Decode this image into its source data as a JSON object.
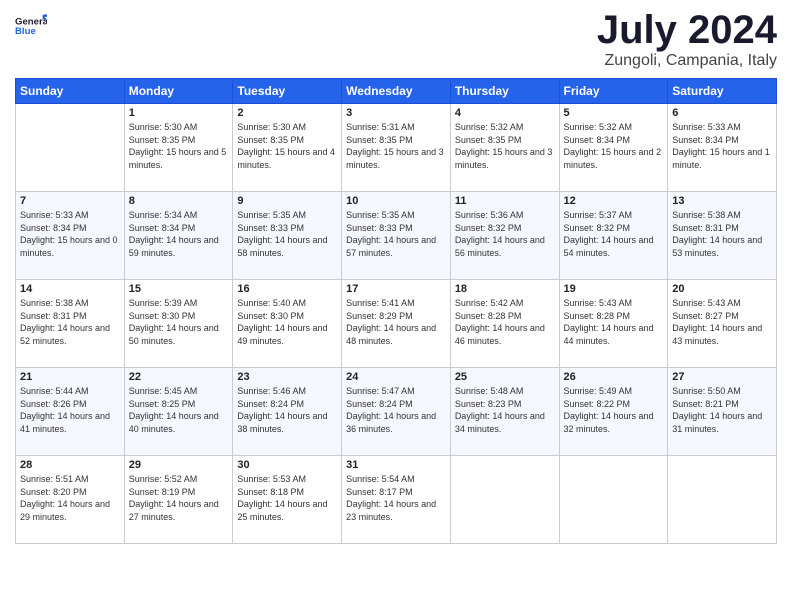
{
  "header": {
    "logo_general": "General",
    "logo_blue": "Blue",
    "month_title": "July 2024",
    "location": "Zungoli, Campania, Italy"
  },
  "days_of_week": [
    "Sunday",
    "Monday",
    "Tuesday",
    "Wednesday",
    "Thursday",
    "Friday",
    "Saturday"
  ],
  "weeks": [
    [
      {
        "day": "",
        "sunrise": "",
        "sunset": "",
        "daylight": ""
      },
      {
        "day": "1",
        "sunrise": "Sunrise: 5:30 AM",
        "sunset": "Sunset: 8:35 PM",
        "daylight": "Daylight: 15 hours and 5 minutes."
      },
      {
        "day": "2",
        "sunrise": "Sunrise: 5:30 AM",
        "sunset": "Sunset: 8:35 PM",
        "daylight": "Daylight: 15 hours and 4 minutes."
      },
      {
        "day": "3",
        "sunrise": "Sunrise: 5:31 AM",
        "sunset": "Sunset: 8:35 PM",
        "daylight": "Daylight: 15 hours and 3 minutes."
      },
      {
        "day": "4",
        "sunrise": "Sunrise: 5:32 AM",
        "sunset": "Sunset: 8:35 PM",
        "daylight": "Daylight: 15 hours and 3 minutes."
      },
      {
        "day": "5",
        "sunrise": "Sunrise: 5:32 AM",
        "sunset": "Sunset: 8:34 PM",
        "daylight": "Daylight: 15 hours and 2 minutes."
      },
      {
        "day": "6",
        "sunrise": "Sunrise: 5:33 AM",
        "sunset": "Sunset: 8:34 PM",
        "daylight": "Daylight: 15 hours and 1 minute."
      }
    ],
    [
      {
        "day": "7",
        "sunrise": "Sunrise: 5:33 AM",
        "sunset": "Sunset: 8:34 PM",
        "daylight": "Daylight: 15 hours and 0 minutes."
      },
      {
        "day": "8",
        "sunrise": "Sunrise: 5:34 AM",
        "sunset": "Sunset: 8:34 PM",
        "daylight": "Daylight: 14 hours and 59 minutes."
      },
      {
        "day": "9",
        "sunrise": "Sunrise: 5:35 AM",
        "sunset": "Sunset: 8:33 PM",
        "daylight": "Daylight: 14 hours and 58 minutes."
      },
      {
        "day": "10",
        "sunrise": "Sunrise: 5:35 AM",
        "sunset": "Sunset: 8:33 PM",
        "daylight": "Daylight: 14 hours and 57 minutes."
      },
      {
        "day": "11",
        "sunrise": "Sunrise: 5:36 AM",
        "sunset": "Sunset: 8:32 PM",
        "daylight": "Daylight: 14 hours and 56 minutes."
      },
      {
        "day": "12",
        "sunrise": "Sunrise: 5:37 AM",
        "sunset": "Sunset: 8:32 PM",
        "daylight": "Daylight: 14 hours and 54 minutes."
      },
      {
        "day": "13",
        "sunrise": "Sunrise: 5:38 AM",
        "sunset": "Sunset: 8:31 PM",
        "daylight": "Daylight: 14 hours and 53 minutes."
      }
    ],
    [
      {
        "day": "14",
        "sunrise": "Sunrise: 5:38 AM",
        "sunset": "Sunset: 8:31 PM",
        "daylight": "Daylight: 14 hours and 52 minutes."
      },
      {
        "day": "15",
        "sunrise": "Sunrise: 5:39 AM",
        "sunset": "Sunset: 8:30 PM",
        "daylight": "Daylight: 14 hours and 50 minutes."
      },
      {
        "day": "16",
        "sunrise": "Sunrise: 5:40 AM",
        "sunset": "Sunset: 8:30 PM",
        "daylight": "Daylight: 14 hours and 49 minutes."
      },
      {
        "day": "17",
        "sunrise": "Sunrise: 5:41 AM",
        "sunset": "Sunset: 8:29 PM",
        "daylight": "Daylight: 14 hours and 48 minutes."
      },
      {
        "day": "18",
        "sunrise": "Sunrise: 5:42 AM",
        "sunset": "Sunset: 8:28 PM",
        "daylight": "Daylight: 14 hours and 46 minutes."
      },
      {
        "day": "19",
        "sunrise": "Sunrise: 5:43 AM",
        "sunset": "Sunset: 8:28 PM",
        "daylight": "Daylight: 14 hours and 44 minutes."
      },
      {
        "day": "20",
        "sunrise": "Sunrise: 5:43 AM",
        "sunset": "Sunset: 8:27 PM",
        "daylight": "Daylight: 14 hours and 43 minutes."
      }
    ],
    [
      {
        "day": "21",
        "sunrise": "Sunrise: 5:44 AM",
        "sunset": "Sunset: 8:26 PM",
        "daylight": "Daylight: 14 hours and 41 minutes."
      },
      {
        "day": "22",
        "sunrise": "Sunrise: 5:45 AM",
        "sunset": "Sunset: 8:25 PM",
        "daylight": "Daylight: 14 hours and 40 minutes."
      },
      {
        "day": "23",
        "sunrise": "Sunrise: 5:46 AM",
        "sunset": "Sunset: 8:24 PM",
        "daylight": "Daylight: 14 hours and 38 minutes."
      },
      {
        "day": "24",
        "sunrise": "Sunrise: 5:47 AM",
        "sunset": "Sunset: 8:24 PM",
        "daylight": "Daylight: 14 hours and 36 minutes."
      },
      {
        "day": "25",
        "sunrise": "Sunrise: 5:48 AM",
        "sunset": "Sunset: 8:23 PM",
        "daylight": "Daylight: 14 hours and 34 minutes."
      },
      {
        "day": "26",
        "sunrise": "Sunrise: 5:49 AM",
        "sunset": "Sunset: 8:22 PM",
        "daylight": "Daylight: 14 hours and 32 minutes."
      },
      {
        "day": "27",
        "sunrise": "Sunrise: 5:50 AM",
        "sunset": "Sunset: 8:21 PM",
        "daylight": "Daylight: 14 hours and 31 minutes."
      }
    ],
    [
      {
        "day": "28",
        "sunrise": "Sunrise: 5:51 AM",
        "sunset": "Sunset: 8:20 PM",
        "daylight": "Daylight: 14 hours and 29 minutes."
      },
      {
        "day": "29",
        "sunrise": "Sunrise: 5:52 AM",
        "sunset": "Sunset: 8:19 PM",
        "daylight": "Daylight: 14 hours and 27 minutes."
      },
      {
        "day": "30",
        "sunrise": "Sunrise: 5:53 AM",
        "sunset": "Sunset: 8:18 PM",
        "daylight": "Daylight: 14 hours and 25 minutes."
      },
      {
        "day": "31",
        "sunrise": "Sunrise: 5:54 AM",
        "sunset": "Sunset: 8:17 PM",
        "daylight": "Daylight: 14 hours and 23 minutes."
      },
      {
        "day": "",
        "sunrise": "",
        "sunset": "",
        "daylight": ""
      },
      {
        "day": "",
        "sunrise": "",
        "sunset": "",
        "daylight": ""
      },
      {
        "day": "",
        "sunrise": "",
        "sunset": "",
        "daylight": ""
      }
    ]
  ]
}
